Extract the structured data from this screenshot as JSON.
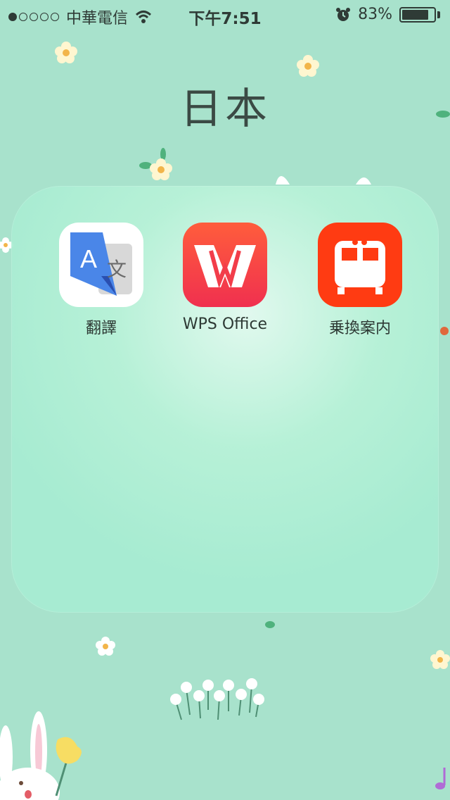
{
  "status_bar": {
    "carrier": "中華電信",
    "time": "下午7:51",
    "battery_percent": "83%",
    "battery_level": 0.83,
    "signal_bars_filled": 1,
    "signal_bars_total": 5,
    "icons": [
      "wifi-icon",
      "alarm-icon",
      "battery-icon"
    ]
  },
  "folder": {
    "title": "日本",
    "apps": [
      {
        "label": "翻譯",
        "icon": "google-translate-icon",
        "glyph_a": "A",
        "glyph_b": "文"
      },
      {
        "label": "WPS Office",
        "icon": "wps-office-icon",
        "glyph": "W"
      },
      {
        "label": "乗換案内",
        "icon": "train-transit-icon"
      }
    ]
  },
  "colors": {
    "wallpaper": "#a8e2cc",
    "wps_red": "#f0304f",
    "train_red": "#ff3b12",
    "translate_blue": "#4a86e8"
  }
}
